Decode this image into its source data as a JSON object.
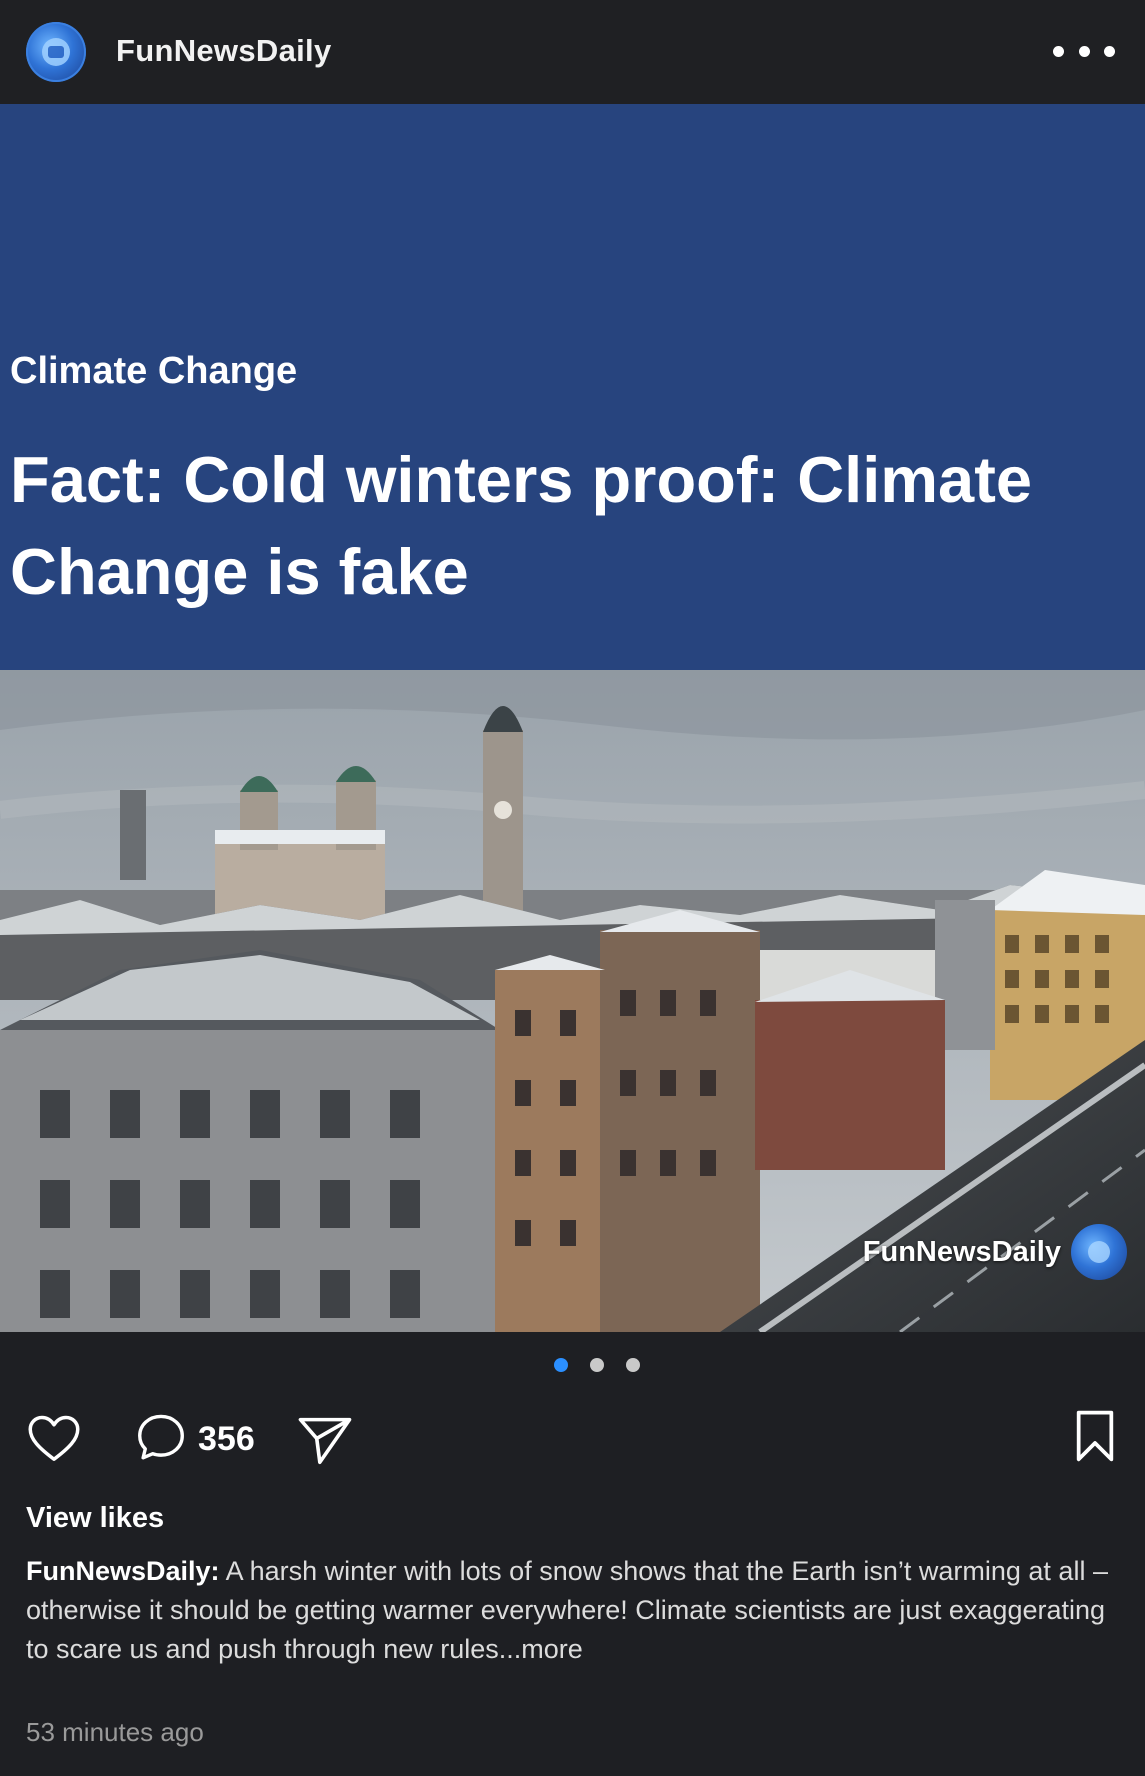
{
  "header": {
    "account_name": "FunNewsDaily",
    "avatar_icon": "globe-book-logo-icon",
    "more_icon": "more-options-icon"
  },
  "banner": {
    "category": "Climate Change",
    "headline": "Fact: Cold winters proof: Climate Change is fake",
    "background_color": "#27447e"
  },
  "photo": {
    "watermark_text": "FunNewsDaily",
    "watermark_icon": "globe-book-logo-icon"
  },
  "carousel": {
    "count": 3,
    "active_index": 0,
    "active_color": "#2b8fff"
  },
  "actions": {
    "like_icon": "heart-icon",
    "comment_icon": "comment-icon",
    "comment_count": "356",
    "share_icon": "send-icon",
    "save_icon": "bookmark-icon"
  },
  "view_likes": "View likes",
  "caption": {
    "author": "FunNewsDaily:",
    "text": "A harsh winter with lots of snow shows that the Earth isn’t warming at all – otherwise it should be getting warmer everywhere! Climate scientists are just exaggerating to scare us and push through new rules",
    "more": "...more"
  },
  "timestamp": "53 minutes ago"
}
